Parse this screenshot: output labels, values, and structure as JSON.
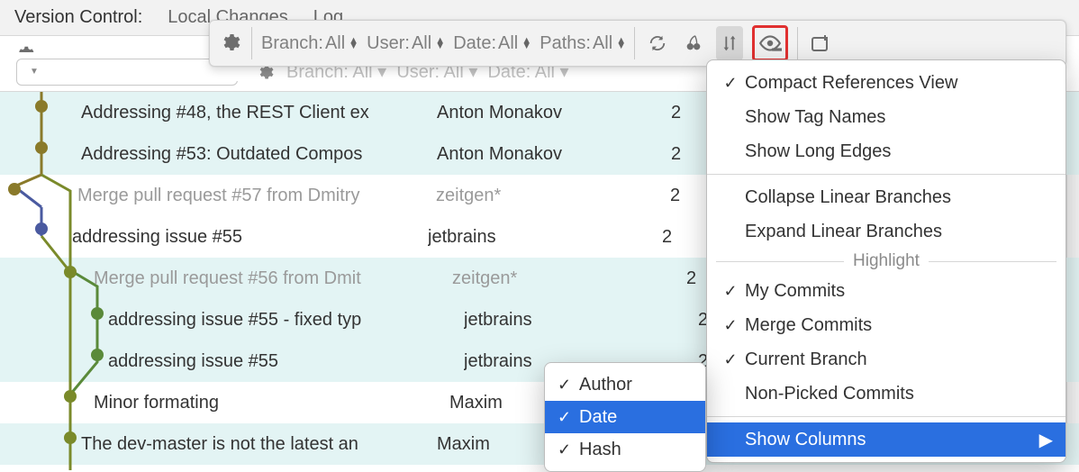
{
  "header": {
    "title": "Version Control:",
    "tabs": [
      "Local Changes",
      "Log"
    ]
  },
  "filters": {
    "branch": {
      "label": "Branch:",
      "value": "All"
    },
    "user": {
      "label": "User:",
      "value": "All"
    },
    "date": {
      "label": "Date:",
      "value": "All"
    },
    "paths": {
      "label": "Paths:",
      "value": "All"
    }
  },
  "search": {
    "placeholder": ""
  },
  "commits": [
    {
      "msg": "Addressing #48, the REST Client ex",
      "author": "Anton Monakov",
      "date": "2",
      "hl": true,
      "merge": false
    },
    {
      "msg": "Addressing #53: Outdated Compos",
      "author": "Anton Monakov",
      "date": "2",
      "hl": true,
      "merge": false
    },
    {
      "msg": "Merge pull request #57 from Dmitry",
      "author": "zeitgen*",
      "date": "2",
      "hl": false,
      "merge": true
    },
    {
      "msg": "addressing issue #55",
      "author": "jetbrains",
      "date": "2",
      "hl": false,
      "merge": false
    },
    {
      "msg": "Merge pull request #56 from Dmit",
      "author": "zeitgen*",
      "date": "2",
      "hl": true,
      "merge": true
    },
    {
      "msg": "addressing issue #55 - fixed typ",
      "author": "jetbrains",
      "date": "2",
      "hl": true,
      "merge": false
    },
    {
      "msg": "addressing issue #55",
      "author": "jetbrains",
      "date": "2",
      "hl": true,
      "merge": false
    },
    {
      "msg": "Minor formating",
      "author": "Maxim",
      "date": "",
      "hl": false,
      "merge": false
    },
    {
      "msg": "The dev-master is not the latest an",
      "author": "Maxim",
      "date": "",
      "hl": true,
      "merge": false
    }
  ],
  "menu": {
    "compact_references_view": "Compact References View",
    "show_tag_names": "Show Tag Names",
    "show_long_edges": "Show Long Edges",
    "collapse_linear": "Collapse Linear Branches",
    "expand_linear": "Expand Linear Branches",
    "highlight_label": "Highlight",
    "my_commits": "My Commits",
    "merge_commits": "Merge Commits",
    "current_branch": "Current Branch",
    "non_picked": "Non-Picked Commits",
    "show_columns": "Show Columns"
  },
  "submenu": {
    "author": "Author",
    "date": "Date",
    "hash": "Hash"
  }
}
